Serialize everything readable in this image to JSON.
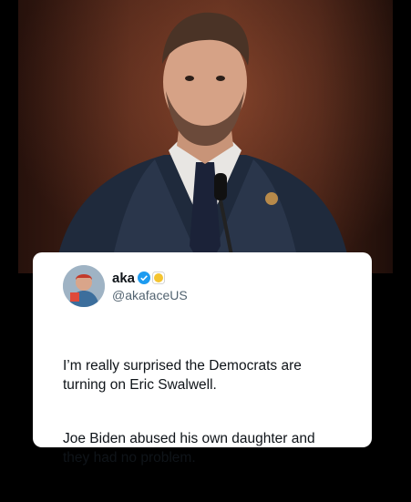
{
  "tweet": {
    "display_name": "aka",
    "handle": "@akafaceUS",
    "paragraphs": [
      "I’m really surprised the Democrats are\nturning on Eric Swalwell.",
      "Joe Biden abused his own daughter and\nthey had no problem."
    ],
    "verified_color": "#1d9bf0",
    "badge_color": "#f4c430"
  },
  "icons": {
    "verified": "verified-check-icon",
    "badge": "gold-badge-icon"
  }
}
